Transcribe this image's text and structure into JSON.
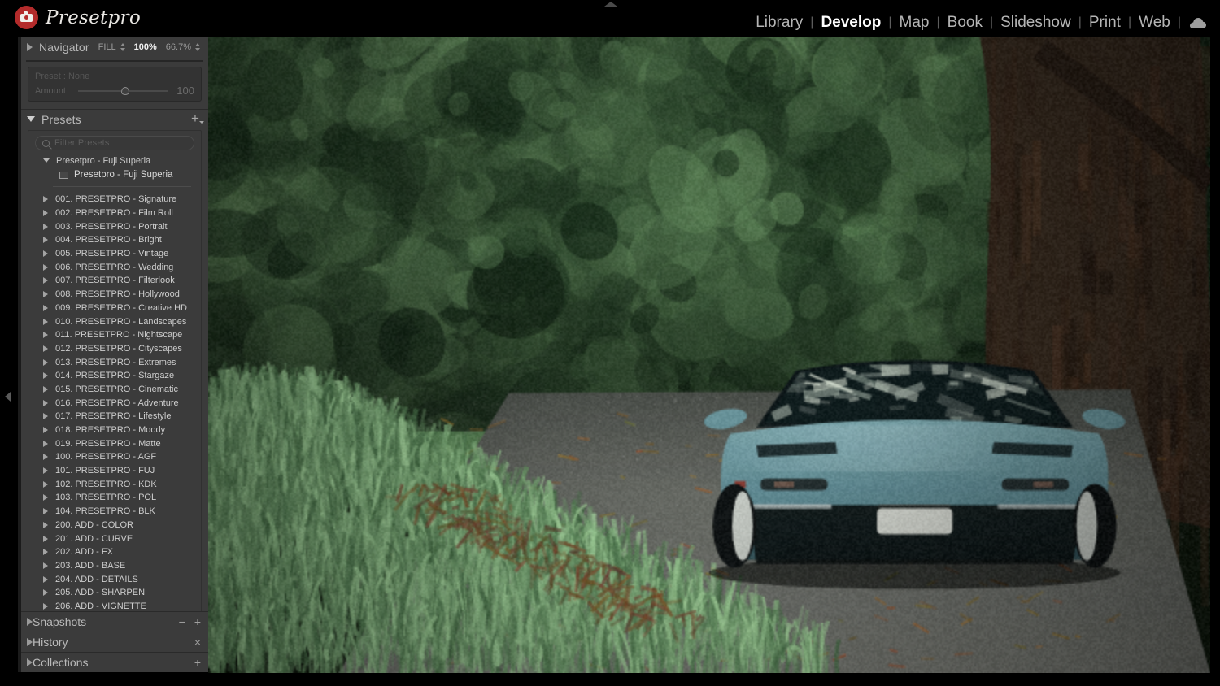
{
  "brand": {
    "name": "Presetpro",
    "logo_icon": "camera-icon",
    "logo_color": "#b32b2b"
  },
  "modules": {
    "items": [
      {
        "label": "Library",
        "active": false
      },
      {
        "label": "Develop",
        "active": true
      },
      {
        "label": "Map",
        "active": false
      },
      {
        "label": "Book",
        "active": false
      },
      {
        "label": "Slideshow",
        "active": false
      },
      {
        "label": "Print",
        "active": false
      },
      {
        "label": "Web",
        "active": false
      }
    ],
    "separator": "|",
    "cloud_icon": "cloud-icon"
  },
  "navigator": {
    "title": "Navigator",
    "fit_label": "FILL",
    "zoom_100": "100%",
    "zoom_custom": "66.7%"
  },
  "amount": {
    "preset_label": "Preset : None",
    "label": "Amount",
    "value": "100",
    "slider_percent": 48
  },
  "presets": {
    "title": "Presets",
    "add_label": "+",
    "filter_placeholder": "Filter Presets",
    "open_group": {
      "name": "Presetpro - Fuji Superia",
      "items": [
        "Presetpro - Fuji Superia"
      ]
    },
    "groups": [
      "001. PRESETPRO - Signature",
      "002. PRESETPRO - Film Roll",
      "003. PRESETPRO - Portrait",
      "004. PRESETPRO - Bright",
      "005. PRESETPRO - Vintage",
      "006. PRESETPRO - Wedding",
      "007. PRESETPRO - Filterlook",
      "008. PRESETPRO - Hollywood",
      "009. PRESETPRO - Creative HD",
      "010. PRESETPRO - Landscapes",
      "011. PRESETPRO - Nightscape",
      "012. PRESETPRO - Cityscapes",
      "013. PRESETPRO - Extremes",
      "014. PRESETPRO - Stargaze",
      "015. PRESETPRO - Cinematic",
      "016. PRESETPRO - Adventure",
      "017. PRESETPRO - Lifestyle",
      "018. PRESETPRO - Moody",
      "019. PRESETPRO - Matte",
      "100. PRESETPRO - AGF",
      "101. PRESETPRO - FUJ",
      "102. PRESETPRO - KDK",
      "103. PRESETPRO - POL",
      "104. PRESETPRO - BLK",
      "200. ADD - COLOR",
      "201. ADD - CURVE",
      "202. ADD - FX",
      "203. ADD - BASE",
      "204. ADD - DETAILS",
      "205. ADD - SHARPEN",
      "206. ADD - VIGNETTE"
    ]
  },
  "bottom_panels": [
    {
      "title": "Snapshots",
      "controls": [
        "−",
        "+"
      ]
    },
    {
      "title": "History",
      "controls": [
        "×"
      ]
    },
    {
      "title": "Collections",
      "controls": [
        "+"
      ]
    }
  ],
  "photo": {
    "description": "Teal sports car on a forest road with green foliage",
    "car_color": "#6f9aa3",
    "foliage_color": "#4e7d45",
    "road_color": "#6c6c68",
    "trunk_color": "#3a2a20"
  }
}
